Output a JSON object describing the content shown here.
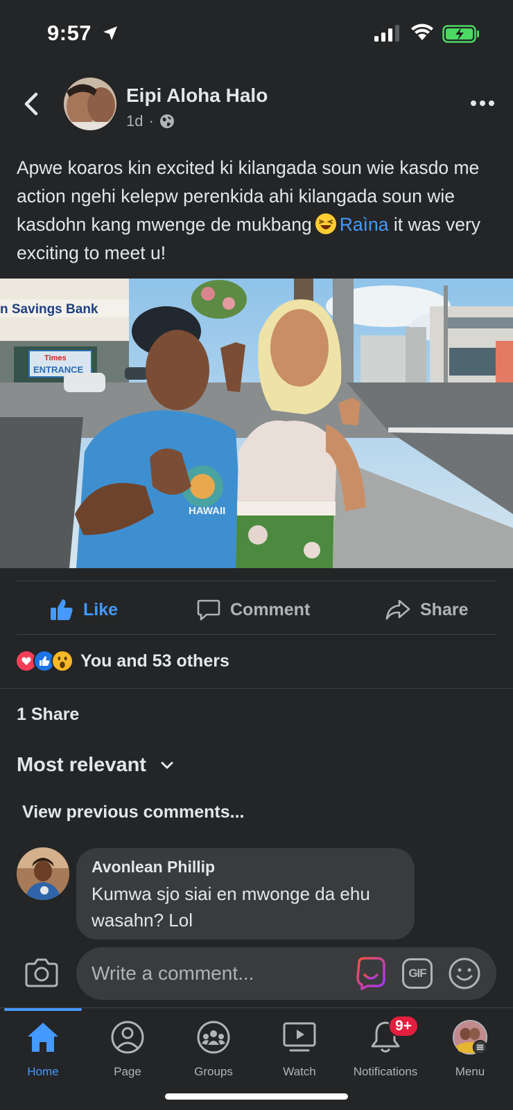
{
  "status_bar": {
    "time": "9:57"
  },
  "post": {
    "author": "Eipi Aloha Halo",
    "age": "1d",
    "audience_icon": "globe-icon",
    "text_part1": "Apwe koaros kin excited ki kilangada soun wie kasdo me action ngehi kelepw perenkida ahi kilangada soun wie kasdohn kang mwenge de mukbang",
    "text_emoji": "laughing-face-emoji",
    "mention": "Raìna",
    "text_part2": "it was very exciting to meet u!"
  },
  "photo": {
    "sign_bank": "n Savings Bank",
    "sign_entrance": "ENTRANCE",
    "sign_times": "Times",
    "shirt_text": "HAWAII"
  },
  "actions": {
    "like": "Like",
    "comment": "Comment",
    "share": "Share"
  },
  "reactions": {
    "types": [
      "love",
      "like",
      "wow"
    ],
    "summary": "You and 53 others"
  },
  "shares_count": "1 Share",
  "sort_label": "Most relevant",
  "view_previous": "View previous comments...",
  "comment": {
    "author": "Avonlean Phillip",
    "text": "Kumwa sjo siai en mwonge da ehu wasahn? Lol"
  },
  "composer": {
    "placeholder": "Write a comment...",
    "gif_label": "GIF"
  },
  "tabs": [
    {
      "label": "Home",
      "icon": "home-icon",
      "active": true
    },
    {
      "label": "Page",
      "icon": "page-profile-icon"
    },
    {
      "label": "Groups",
      "icon": "groups-icon"
    },
    {
      "label": "Watch",
      "icon": "watch-icon"
    },
    {
      "label": "Notifications",
      "icon": "bell-icon",
      "badge": "9+"
    },
    {
      "label": "Menu",
      "icon": "menu-avatar-icon"
    }
  ],
  "colors": {
    "background": "#242526",
    "accent": "#4599ff",
    "bubble": "#3a3b3c",
    "badge": "#e41e3f"
  }
}
